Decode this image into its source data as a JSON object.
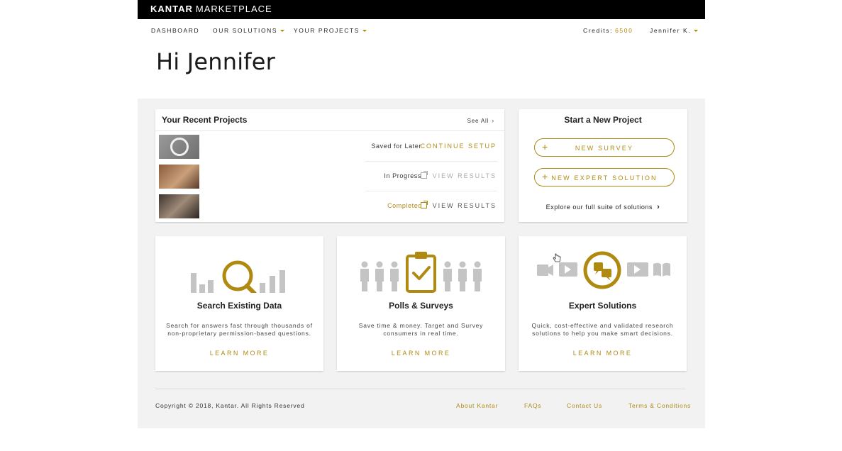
{
  "brand": {
    "name_bold": "KANTAR",
    "name_light": "MARKETPLACE"
  },
  "nav": {
    "dashboard": "DASHBOARD",
    "solutions": "OUR SOLUTIONS",
    "projects": "YOUR PROJECTS",
    "credits_label": "Credits:",
    "credits_value": "6500",
    "user": "Jennifer K."
  },
  "greeting": "Hi Jennifer",
  "recent": {
    "title": "Your Recent Projects",
    "see_all": "See All",
    "rows": [
      {
        "status": "Saved for Later",
        "action": "CONTINUE SETUP"
      },
      {
        "status": "In Progress",
        "action": "VIEW RESULTS"
      },
      {
        "status": "Completed",
        "action": "VIEW RESULTS"
      }
    ]
  },
  "start": {
    "title": "Start a New Project",
    "survey": "NEW SURVEY",
    "expert": "NEW EXPERT SOLUTION",
    "explore": "Explore our full suite of solutions"
  },
  "features": [
    {
      "title": "Search Existing Data",
      "desc": "Search for answers fast through thousands of non-proprietary permission-based questions.",
      "link": "LEARN MORE"
    },
    {
      "title": "Polls & Surveys",
      "desc": "Save time & money. Target and Survey consumers in real time.",
      "link": "LEARN MORE"
    },
    {
      "title": "Expert Solutions",
      "desc": "Quick, cost-effective and validated research solutions to help you make smart decisions.",
      "link": "LEARN MORE"
    }
  ],
  "footer": {
    "copyright": "Copyright © 2018, Kantar. All Rights Reserved",
    "about": "About Kantar",
    "faqs": "FAQs",
    "contact": "Contact Us",
    "terms": "Terms & Conditions"
  },
  "colors": {
    "accent": "#b08a10",
    "topbar": "#000000",
    "content_bg": "#f2f2f2",
    "icon_grey": "#c4c4c4"
  }
}
